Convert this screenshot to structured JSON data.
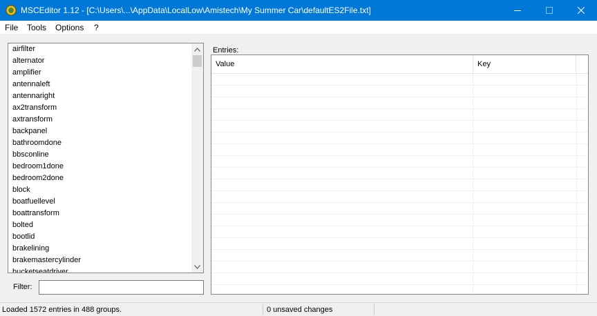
{
  "window": {
    "title": "MSCEditor 1.12 - [C:\\Users\\...\\AppData\\LocalLow\\Amistech\\My Summer Car\\defaultES2File.txt]",
    "icon": "msceditor-app-icon"
  },
  "menu": {
    "file": "File",
    "tools": "Tools",
    "options": "Options",
    "help": "?"
  },
  "groups": {
    "items": [
      "airfilter",
      "alternator",
      "amplifier",
      "antennaleft",
      "antennaright",
      "ax2transform",
      "axtransform",
      "backpanel",
      "bathroomdone",
      "bbsconline",
      "bedroom1done",
      "bedroom2done",
      "block",
      "boatfuellevel",
      "boattransform",
      "bolted",
      "bootlid",
      "brakelining",
      "brakemastercylinder",
      "bucketseatdriver"
    ]
  },
  "filter": {
    "label": "Filter:",
    "value": ""
  },
  "entries": {
    "label": "Entries:",
    "columns": [
      "Value",
      "Key"
    ],
    "rows": []
  },
  "status": {
    "loaded": "Loaded 1572 entries in 488 groups.",
    "unsaved": "0 unsaved changes"
  }
}
